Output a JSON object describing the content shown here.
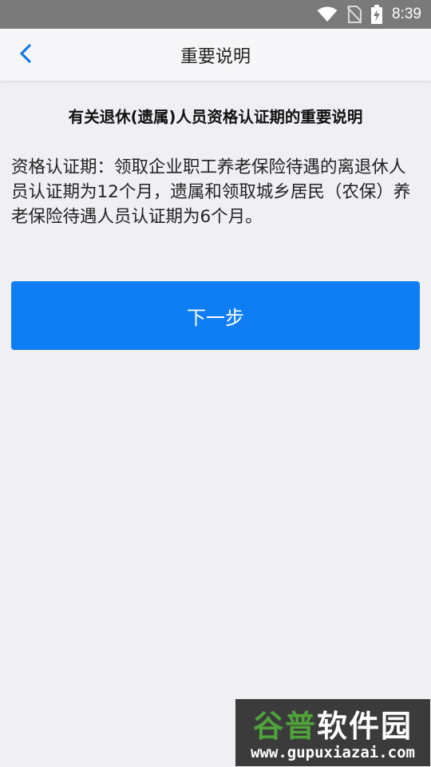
{
  "status_bar": {
    "time": "8:39",
    "icons": [
      "wifi-icon",
      "no-sim-icon",
      "battery-charging-icon"
    ],
    "color": "#7a7a7a"
  },
  "header": {
    "title": "重要说明",
    "back_icon": "chevron-left-icon",
    "accent": "#1677e8"
  },
  "notice": {
    "heading": "有关退休(遗属)人员资格认证期的重要说明",
    "body": "资格认证期：领取企业职工养老保险待遇的离退休人员认证期为12个月，遗属和领取城乡居民（农保）养老保险待遇人员认证期为6个月。"
  },
  "actions": {
    "next_label": "下一步",
    "button_color": "#0f7ef5"
  },
  "watermark": {
    "brand_part1": "谷普",
    "brand_part2": "软件园",
    "url": "www.gupuxiazai.com"
  }
}
